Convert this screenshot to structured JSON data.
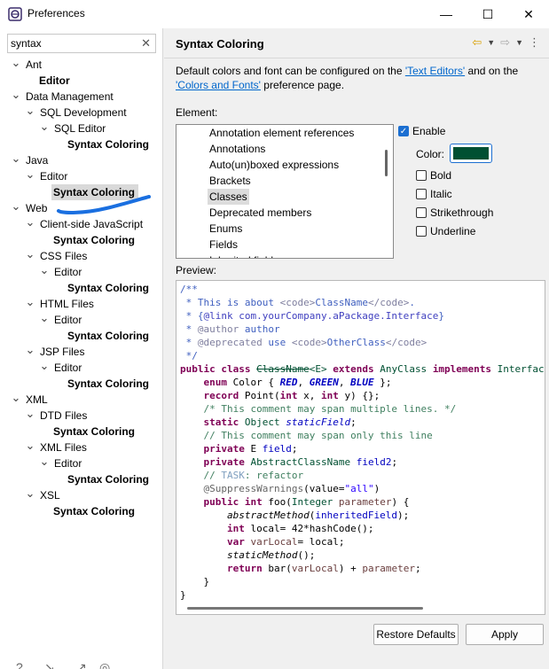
{
  "window": {
    "title": "Preferences",
    "minimize": "—",
    "maximize": "☐",
    "close": "✕"
  },
  "filter": {
    "value": "syntax",
    "clear_icon": "✕"
  },
  "tree": [
    {
      "label": "Ant",
      "expanded": true,
      "bold": false
    },
    {
      "label": "Editor",
      "bold": true
    },
    {
      "label": "Data Management",
      "expanded": true,
      "bold": false
    },
    {
      "label": "SQL Development",
      "expanded": true,
      "bold": false
    },
    {
      "label": "SQL Editor",
      "expanded": true,
      "bold": false
    },
    {
      "label": "Syntax Coloring",
      "bold": true
    },
    {
      "label": "Java",
      "expanded": true,
      "bold": false
    },
    {
      "label": "Editor",
      "expanded": true,
      "bold": false
    },
    {
      "label": "Syntax Coloring",
      "bold": true,
      "selected": true
    },
    {
      "label": "Web",
      "expanded": true,
      "bold": false
    },
    {
      "label": "Client-side JavaScript",
      "expanded": true,
      "bold": false
    },
    {
      "label": "Syntax Coloring",
      "bold": true
    },
    {
      "label": "CSS Files",
      "expanded": true,
      "bold": false
    },
    {
      "label": "Editor",
      "expanded": true,
      "bold": false
    },
    {
      "label": "Syntax Coloring",
      "bold": true
    },
    {
      "label": "HTML Files",
      "expanded": true,
      "bold": false
    },
    {
      "label": "Editor",
      "expanded": true,
      "bold": false
    },
    {
      "label": "Syntax Coloring",
      "bold": true
    },
    {
      "label": "JSP Files",
      "expanded": true,
      "bold": false
    },
    {
      "label": "Editor",
      "expanded": true,
      "bold": false
    },
    {
      "label": "Syntax Coloring",
      "bold": true
    },
    {
      "label": "XML",
      "expanded": true,
      "bold": false
    },
    {
      "label": "DTD Files",
      "expanded": true,
      "bold": false
    },
    {
      "label": "Syntax Coloring",
      "bold": true
    },
    {
      "label": "XML Files",
      "expanded": true,
      "bold": false
    },
    {
      "label": "Editor",
      "expanded": true,
      "bold": false
    },
    {
      "label": "Syntax Coloring",
      "bold": true
    },
    {
      "label": "XSL",
      "expanded": true,
      "bold": false
    },
    {
      "label": "Syntax Coloring",
      "bold": true
    }
  ],
  "page": {
    "title": "Syntax Coloring",
    "description_pre": "Default colors and font can be configured on the ",
    "link_text_editors": "'Text Editors'",
    "description_mid": " and on the ",
    "link_colors_fonts": "'Colors and Fonts'",
    "description_post": " preference page.",
    "element_label": "Element:",
    "elements": [
      "Annotation element references",
      "Annotations",
      "Auto(un)boxed expressions",
      "Brackets",
      "Classes",
      "Deprecated members",
      "Enums",
      "Fields",
      "Inherited fields"
    ],
    "selected_element": "Classes",
    "enable_label": "Enable",
    "enable_checked": true,
    "color_label": "Color:",
    "color_value": "#005032",
    "bold_label": "Bold",
    "italic_label": "Italic",
    "strikethrough_label": "Strikethrough",
    "underline_label": "Underline",
    "preview_label": "Preview:",
    "restore_defaults": "Restore Defaults",
    "apply": "Apply"
  },
  "colors": {
    "accent": "#1c6fd1",
    "annotation_stroke": "#1a6fe0"
  }
}
